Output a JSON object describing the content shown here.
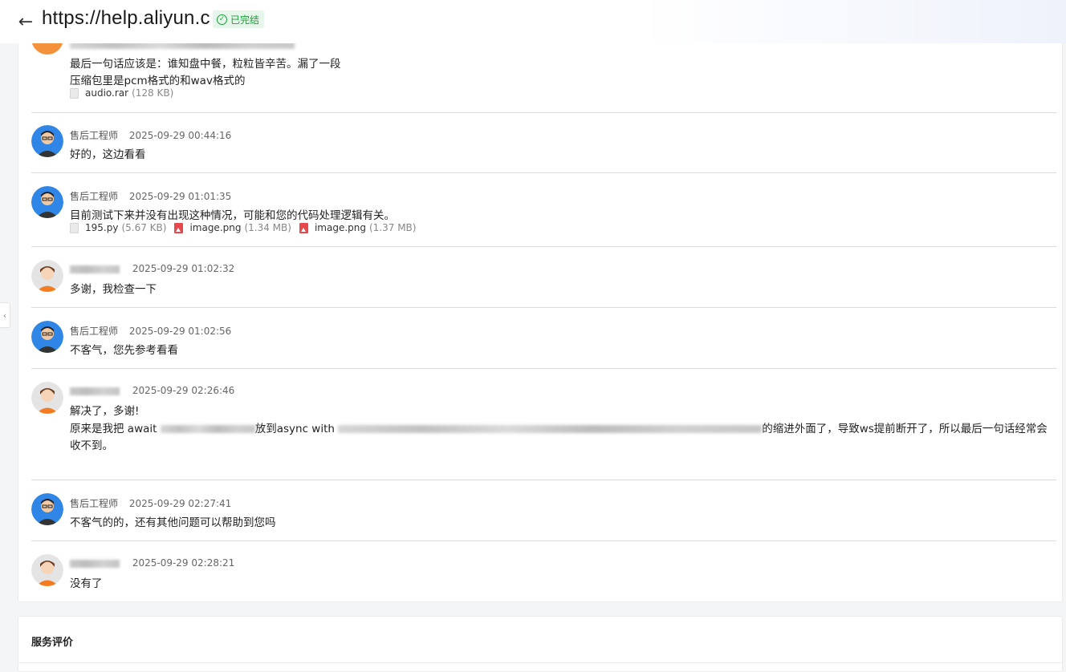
{
  "header": {
    "title": "https://help.aliyun.c",
    "status": "已完结",
    "back_icon": "arrow-left-icon"
  },
  "messages": [
    {
      "type": "user",
      "lines": [
        "最后一句话应该是：谁知盘中餐，粒粒皆辛苦。漏了一段",
        "压缩包里是pcm格式的和wav格式的"
      ],
      "attachments": [
        {
          "name": "audio.rar",
          "size": "(128 KB)",
          "kind": "file"
        }
      ]
    },
    {
      "type": "engineer",
      "name": "售后工程师",
      "time": "2025-09-29 00:44:16",
      "lines": [
        "好的，这边看看"
      ]
    },
    {
      "type": "engineer",
      "name": "售后工程师",
      "time": "2025-09-29 01:01:35",
      "lines": [
        "目前测试下来并没有出现这种情况，可能和您的代码处理逻辑有关。"
      ],
      "attachments": [
        {
          "name": "195.py",
          "size": "(5.67 KB)",
          "kind": "file"
        },
        {
          "name": "image.png",
          "size": "(1.34 MB)",
          "kind": "image"
        },
        {
          "name": "image.png",
          "size": "(1.37 MB)",
          "kind": "image"
        }
      ]
    },
    {
      "type": "user",
      "time": "2025-09-29 01:02:32",
      "lines": [
        "多谢，我检查一下"
      ]
    },
    {
      "type": "engineer",
      "name": "售后工程师",
      "time": "2025-09-29 01:02:56",
      "lines": [
        "不客气，您先参考看看"
      ]
    },
    {
      "type": "user",
      "time": "2025-09-29 02:26:46",
      "lines": [
        "解决了，多谢!"
      ],
      "line2_parts": [
        "原来是我把 await ",
        "放到async with ",
        "的缩进外面了，导致ws提前断开了，所以最后一句话经常会"
      ],
      "line3": "收不到。"
    },
    {
      "type": "engineer",
      "name": "售后工程师",
      "time": "2025-09-29 02:27:41",
      "lines": [
        "不客气的的，还有其他问题可以帮助到您吗"
      ]
    },
    {
      "type": "user",
      "time": "2025-09-29 02:28:21",
      "lines": [
        "没有了"
      ]
    }
  ],
  "rating": {
    "title": "服务评价"
  }
}
